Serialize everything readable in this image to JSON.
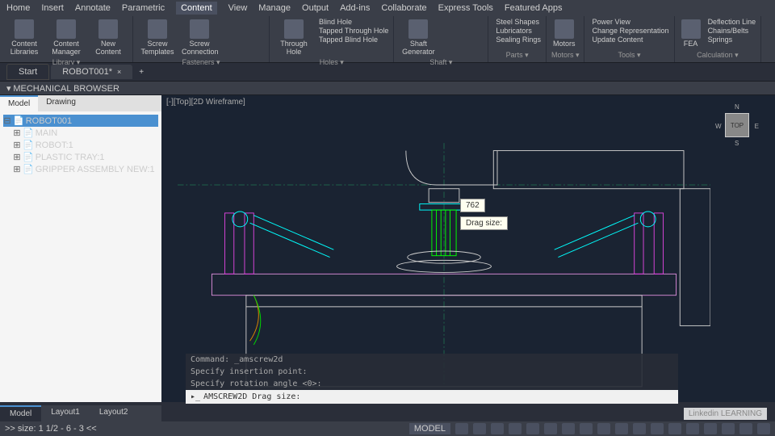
{
  "menu": [
    "Home",
    "Insert",
    "Annotate",
    "Parametric",
    "Content",
    "View",
    "Manage",
    "Output",
    "Add-ins",
    "Collaborate",
    "Express Tools",
    "Featured Apps"
  ],
  "menu_active": 4,
  "ribbon_groups": [
    {
      "label": "Library",
      "big": [
        {
          "name": "content-libraries",
          "label": "Content Libraries"
        },
        {
          "name": "content-manager",
          "label": "Content Manager"
        },
        {
          "name": "new-content",
          "label": "New Content"
        }
      ]
    },
    {
      "label": "Fasteners",
      "big": [
        {
          "name": "screw-templates",
          "label": "Screw Templates"
        },
        {
          "name": "screw-connection",
          "label": "Screw Connection"
        }
      ],
      "small": [
        "s1",
        "s2",
        "s3",
        "s4",
        "s5",
        "s6"
      ]
    },
    {
      "label": "Holes",
      "big": [
        {
          "name": "through-hole",
          "label": "Through Hole"
        }
      ],
      "list": [
        {
          "name": "blind-hole",
          "label": "Blind Hole"
        },
        {
          "name": "tapped-through-hole",
          "label": "Tapped Through Hole"
        },
        {
          "name": "tapped-blind-hole",
          "label": "Tapped Blind Hole"
        }
      ]
    },
    {
      "label": "Shaft",
      "big": [
        {
          "name": "shaft-generator",
          "label": "Shaft Generator"
        }
      ],
      "small": [
        "sh1",
        "sh2",
        "sh3",
        "sh4"
      ]
    },
    {
      "label": "Parts",
      "list": [
        {
          "name": "steel-shapes",
          "label": "Steel Shapes"
        },
        {
          "name": "lubricators",
          "label": "Lubricators"
        },
        {
          "name": "sealing-rings",
          "label": "Sealing Rings"
        }
      ]
    },
    {
      "label": "Motors",
      "big": [
        {
          "name": "motors",
          "label": "Motors"
        }
      ]
    },
    {
      "label": "Tools",
      "list": [
        {
          "name": "power-view",
          "label": "Power View"
        },
        {
          "name": "change-representation",
          "label": "Change Representation"
        },
        {
          "name": "update-content",
          "label": "Update Content"
        }
      ]
    },
    {
      "label": "Calculation",
      "big": [
        {
          "name": "fea",
          "label": "FEA"
        }
      ],
      "list": [
        {
          "name": "deflection-line",
          "label": "Deflection Line"
        },
        {
          "name": "chains-belts",
          "label": "Chains/Belts"
        },
        {
          "name": "springs",
          "label": "Springs"
        }
      ]
    }
  ],
  "doc_tabs": {
    "start": "Start",
    "active": "ROBOT001*"
  },
  "panel_title": "MECHANICAL BROWSER",
  "browser_tabs": [
    "Model",
    "Drawing"
  ],
  "browser_active": 0,
  "tree": [
    {
      "label": "ROBOT001",
      "level": 0,
      "selected": true,
      "exp": "-"
    },
    {
      "label": "MAIN",
      "level": 1,
      "exp": "+"
    },
    {
      "label": "ROBOT:1",
      "level": 1,
      "exp": "+"
    },
    {
      "label": "PLASTIC TRAY:1",
      "level": 1,
      "exp": "+"
    },
    {
      "label": "GRIPPER ASSEMBLY NEW:1",
      "level": 1,
      "exp": "+"
    }
  ],
  "view_label": "[-][Top][2D Wireframe]",
  "viewcube": {
    "face": "TOP",
    "n": "N",
    "e": "E",
    "s": "S",
    "w": "W"
  },
  "tooltips": {
    "measure": "762",
    "dragsize": "Drag size:"
  },
  "command": {
    "history": [
      "Command: _amscrew2d",
      "Specify insertion point:",
      "Specify rotation angle <0>:"
    ],
    "prompt": "AMSCREW2D Drag size:"
  },
  "layout_tabs": [
    "Model",
    "Layout1",
    "Layout2"
  ],
  "layout_active": 0,
  "status": {
    "size_label": ">> size: 1 1/2 - 6 - 3 <<",
    "model": "MODEL"
  },
  "watermark": "Linkedin LEARNING"
}
